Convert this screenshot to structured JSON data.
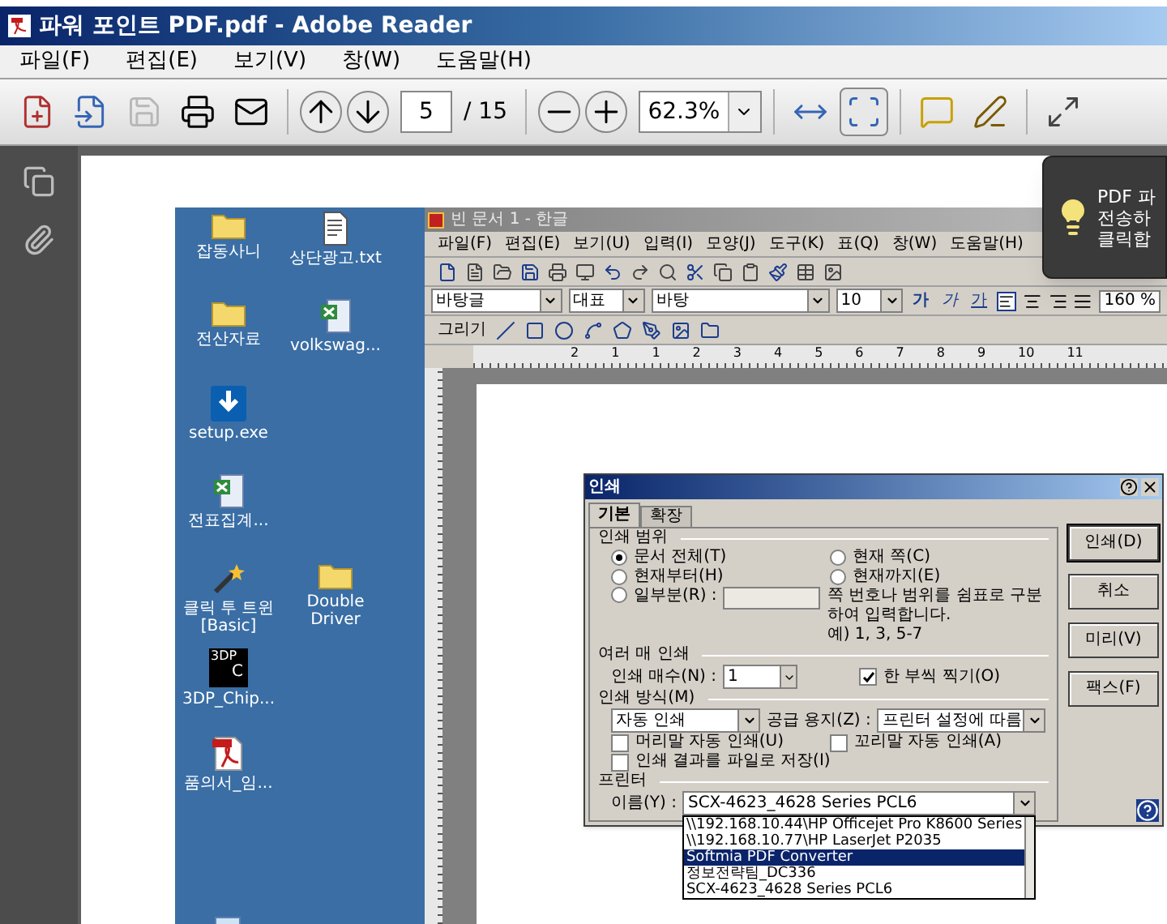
{
  "window": {
    "title": "파워 포인트 PDF.pdf - Adobe Reader"
  },
  "menu": [
    "파일(F)",
    "편집(E)",
    "보기(V)",
    "창(W)",
    "도움말(H)"
  ],
  "toolbar": {
    "page": "5",
    "page_total": "/ 15",
    "zoom": "62.3%"
  },
  "tooltip": {
    "lines": [
      "PDF 파",
      "전송하",
      "클릭합"
    ]
  },
  "desktop": {
    "icon_rows": [
      [
        {
          "kind": "folder",
          "label": "잡동사니"
        },
        {
          "kind": "text",
          "label": "상단광고.txt"
        }
      ],
      [
        {
          "kind": "folder",
          "label": "전산자료"
        },
        {
          "kind": "sheet",
          "label": "volkswag..."
        }
      ],
      [
        {
          "kind": "setup",
          "label": "setup.exe"
        }
      ],
      [
        {
          "kind": "sheet",
          "label": "전표집계..."
        }
      ],
      [
        {
          "kind": "wand",
          "label": "클릭 투 트윈 [Basic]"
        },
        {
          "kind": "folder",
          "label": "Double Driver"
        }
      ],
      [
        {
          "kind": "app",
          "label": "3DP_Chip...",
          "icon_text": [
            "3DP",
            "C"
          ]
        }
      ],
      [
        {
          "kind": "pdf",
          "label": "품의서_임..."
        }
      ],
      [
        {
          "kind": "installer"
        }
      ]
    ]
  },
  "hangul": {
    "title": "빈 문서 1 - 한글",
    "menu": [
      "파일(F)",
      "편집(E)",
      "보기(U)",
      "입력(I)",
      "모양(J)",
      "도구(K)",
      "표(Q)",
      "창(W)",
      "도움말(H)"
    ],
    "style": "바탕글",
    "shape": "대표",
    "font": "바탕",
    "size": "10",
    "text_styles": [
      "가",
      "가",
      "가"
    ],
    "line_spacing": "160 %",
    "draw_label": "그리기",
    "ruler": [
      "2",
      "1",
      "1",
      "2",
      "3",
      "4",
      "5",
      "6",
      "7",
      "8",
      "9",
      "10",
      "11"
    ]
  },
  "dialog": {
    "title": "인쇄",
    "tabs": [
      {
        "label": "기본",
        "selected": true
      },
      {
        "label": "확장",
        "selected": false
      }
    ],
    "range": {
      "heading": "인쇄 범위",
      "options": [
        {
          "label": "문서 전체(T)",
          "selected": true
        },
        {
          "label": "현재 쪽(C)",
          "selected": false
        },
        {
          "label": "현재부터(H)",
          "selected": false
        },
        {
          "label": "현재까지(E)",
          "selected": false
        },
        {
          "label": "일부분(R) :",
          "selected": false
        }
      ],
      "note": "쪽 번호나 범위를 쉼표로 구분하여 입력합니다.",
      "example": "예) 1, 3, 5-7"
    },
    "copies": {
      "heading": "여러 매 인쇄",
      "label": "인쇄 매수(N) :",
      "value": "1",
      "collate": {
        "label": "한 부씩 찍기(O)",
        "checked": true
      }
    },
    "method": {
      "heading": "인쇄 방식(M)",
      "mode": "자동 인쇄",
      "paper_label": "공급 용지(Z) :",
      "paper": "프린터 설정에 따름",
      "options": [
        {
          "label": "머리말 자동 인쇄(U)",
          "checked": false
        },
        {
          "label": "꼬리말 자동 인쇄(A)",
          "checked": false
        },
        {
          "label": "인쇄 결과를 파일로 저장(I)",
          "checked": false
        }
      ]
    },
    "printer": {
      "heading": "프린터",
      "label": "이름(Y) :",
      "name": "SCX-4623_4628 Series PCL6",
      "list": [
        {
          "label": "\\\\192.168.10.44\\HP Officejet Pro K8600 Series",
          "selected": false
        },
        {
          "label": "\\\\192.168.10.77\\HP LaserJet P2035",
          "selected": false
        },
        {
          "label": "Softmia PDF Converter",
          "selected": true
        },
        {
          "label": "정보전략팀_DC336",
          "selected": false
        },
        {
          "label": "SCX-4623_4628 Series PCL6",
          "selected": false
        }
      ]
    },
    "buttons": [
      "인쇄(D)",
      "취소",
      "미리(V)",
      "팩스(F)"
    ]
  }
}
